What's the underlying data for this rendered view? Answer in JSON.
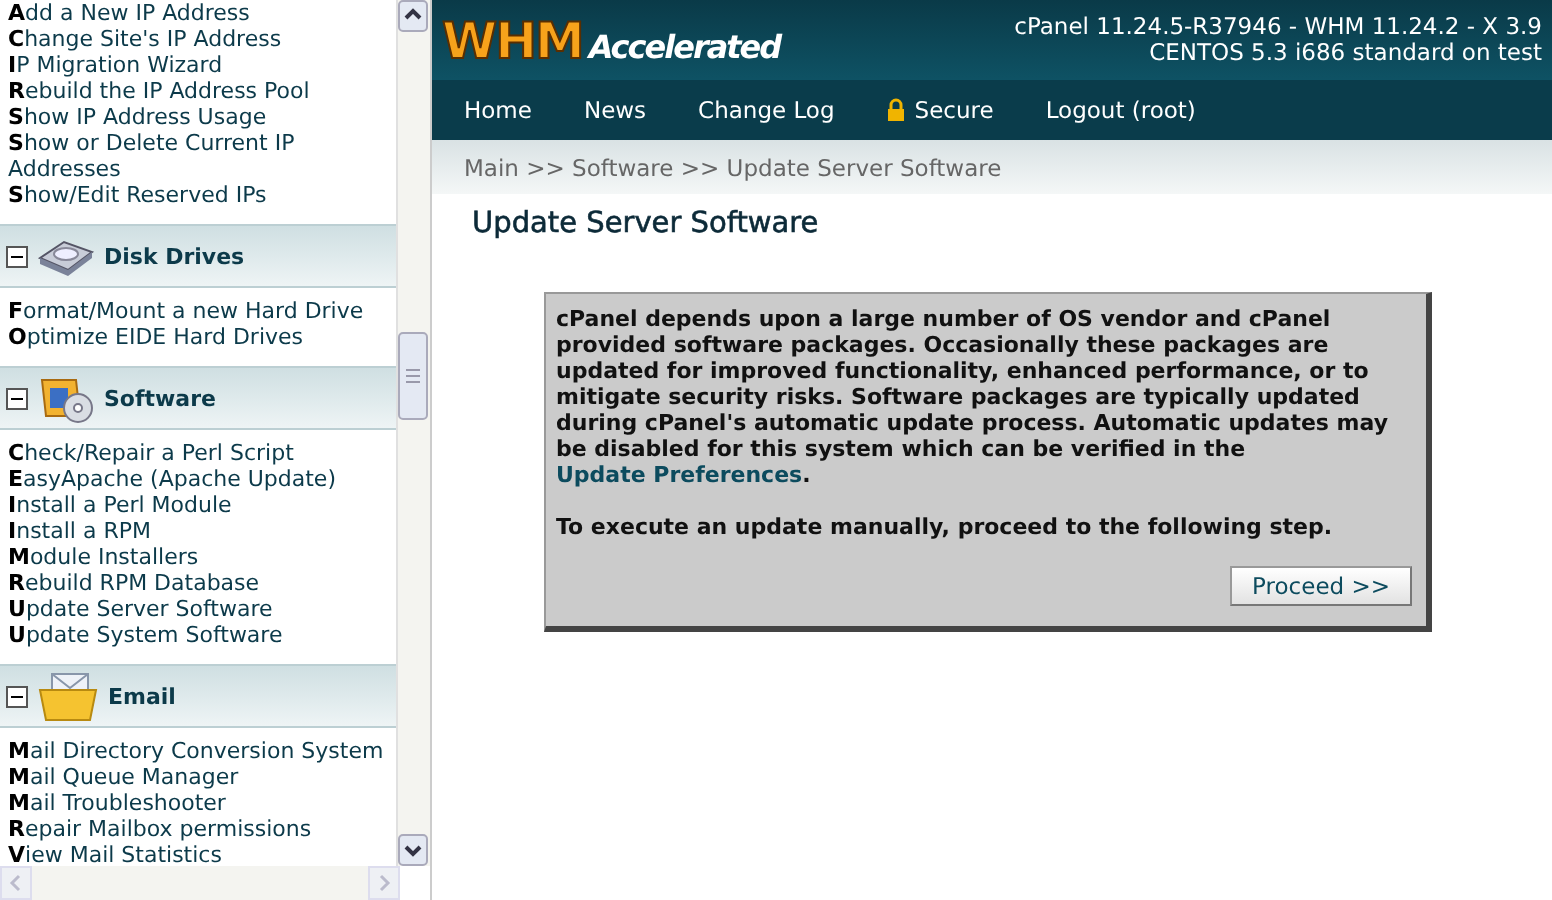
{
  "sidebar": {
    "top_items": [
      "**A**dd a New IP Address",
      "**C**hange Site's IP Address",
      "**I**P Migration Wizard",
      "**R**ebuild the IP Address Pool",
      "**S**how IP Address Usage",
      "**S**how or Delete Current IP Addresses",
      "**S**how/Edit Reserved IPs"
    ],
    "sections": [
      {
        "title": "Disk Drives",
        "kind": "disk",
        "expanded": true,
        "items": [
          "**F**ormat/Mount a new Hard Drive",
          "**O**ptimize EIDE Hard Drives"
        ]
      },
      {
        "title": "Software",
        "kind": "software",
        "expanded": true,
        "items": [
          "**C**heck/Repair a Perl Script",
          "**E**asyApache (Apache Update)",
          "**I**nstall a Perl Module",
          "**I**nstall a RPM",
          "**M**odule Installers",
          "**R**ebuild RPM Database",
          "**U**pdate Server Software",
          "**U**pdate System Software"
        ]
      },
      {
        "title": "Email",
        "kind": "email",
        "expanded": true,
        "items": [
          "**M**ail Directory Conversion System",
          "**M**ail Queue Manager",
          "**M**ail Troubleshooter",
          "**R**epair Mailbox permissions",
          "**V**iew Mail Statistics"
        ]
      }
    ]
  },
  "header": {
    "logo_main": "WHM",
    "logo_sub": "Accelerated",
    "version_lines": [
      "cPanel 11.24.5-R37946 - WHM 11.24.2 - X 3.9",
      "CENTOS 5.3 i686 standard on test"
    ]
  },
  "nav": [
    {
      "label": "Home",
      "kind": "plain"
    },
    {
      "label": "News",
      "kind": "plain"
    },
    {
      "label": "Change Log",
      "kind": "plain"
    },
    {
      "label": "Secure",
      "kind": "lock"
    },
    {
      "label": "Logout (root)",
      "kind": "plain"
    }
  ],
  "breadcrumb": "Main >> Software >> Update Server Software",
  "page_title": "Update Server Software",
  "notice": {
    "text_before": "cPanel depends upon a large number of OS vendor and cPanel provided software packages. Occasionally these packages are updated for improved functionality, enhanced performance, or to mitigate security risks. Software packages are typically updated during cPanel's automatic update process. Automatic updates may be disabled for this system which can be verified in the ",
    "link": "Update Preferences",
    "text_after": ".",
    "instruction": "To execute an update manually, proceed to the following step.",
    "button": "Proceed >>"
  }
}
